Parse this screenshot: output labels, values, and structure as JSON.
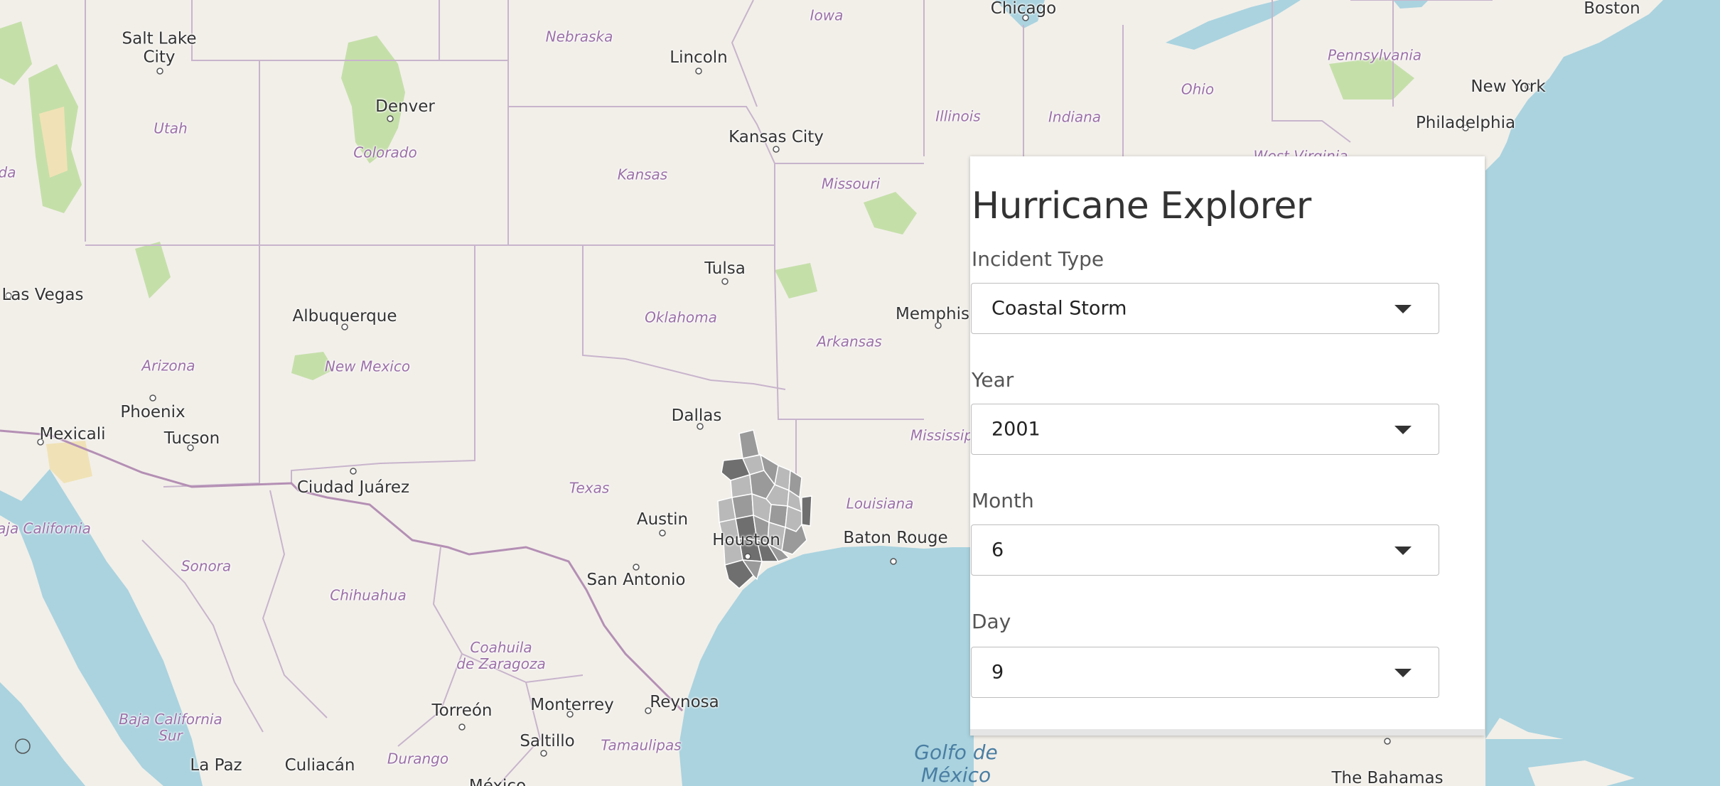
{
  "app": {
    "title": "Hurricane Explorer"
  },
  "filters": {
    "incident_type": {
      "label": "Incident Type",
      "value": "Coastal Storm"
    },
    "year": {
      "label": "Year",
      "value": "2001"
    },
    "month": {
      "label": "Month",
      "value": "6"
    },
    "day": {
      "label": "Day",
      "value": "9"
    }
  },
  "map": {
    "colors": {
      "land": "#f2efe9",
      "water": "#aad3df",
      "state_border": "#c8b4cc",
      "country_border": "#b48fb4",
      "park": "#c5dfa9",
      "desert": "#f0e2b6",
      "county_light": "#b9b9b9",
      "county_mid": "#9a9a9a",
      "county_dark": "#6f6f6f"
    },
    "labels": {
      "cities": {
        "salt_lake_city": "Salt Lake\nCity",
        "lincoln": "Lincoln",
        "chicago": "Chicago",
        "boston": "Boston",
        "new_york": "New York",
        "philadelphia": "Philadelphia",
        "denver": "Denver",
        "kansas_city": "Kansas City",
        "las_vegas": "Las Vegas",
        "tulsa": "Tulsa",
        "albuquerque": "Albuquerque",
        "memphis": "Memphis",
        "phoenix": "Phoenix",
        "mexicali": "Mexicali",
        "tucson": "Tucson",
        "dallas": "Dallas",
        "ciudad_juarez": "Ciudad Juárez",
        "austin": "Austin",
        "houston": "Houston",
        "baton_rouge": "Baton Rouge",
        "san_antonio": "San Antonio",
        "torreon": "Torreón",
        "monterrey": "Monterrey",
        "reynosa": "Reynosa",
        "saltillo": "Saltillo",
        "la_paz": "La Paz",
        "culiacan": "Culiacán",
        "mexico": "México",
        "the_bahamas": "The Bahamas"
      },
      "states": {
        "iowa": "Iowa",
        "nebraska": "Nebraska",
        "pennsylvania": "Pennsylvania",
        "ohio": "Ohio",
        "illinois": "Illinois",
        "indiana": "Indiana",
        "utah": "Utah",
        "colorado": "Colorado",
        "kansas": "Kansas",
        "missouri": "Missouri",
        "west_virginia": "West Virginia",
        "oklahoma": "Oklahoma",
        "arkansas": "Arkansas",
        "arizona": "Arizona",
        "new_mexico": "New Mexico",
        "mississippi": "Mississip",
        "texas": "Texas",
        "louisiana": "Louisiana",
        "baja_california": "aja California",
        "sonora": "Sonora",
        "chihuahua": "Chihuahua",
        "coahuila": "Coahuila\nde Zaragoza",
        "baja_california_sur": "Baja California\nSur",
        "durango": "Durango",
        "tamaulipas": "Tamaulipas",
        "nevada_fragment": "da"
      },
      "water": {
        "gulf": "Golfo de\nMéxico"
      }
    }
  }
}
